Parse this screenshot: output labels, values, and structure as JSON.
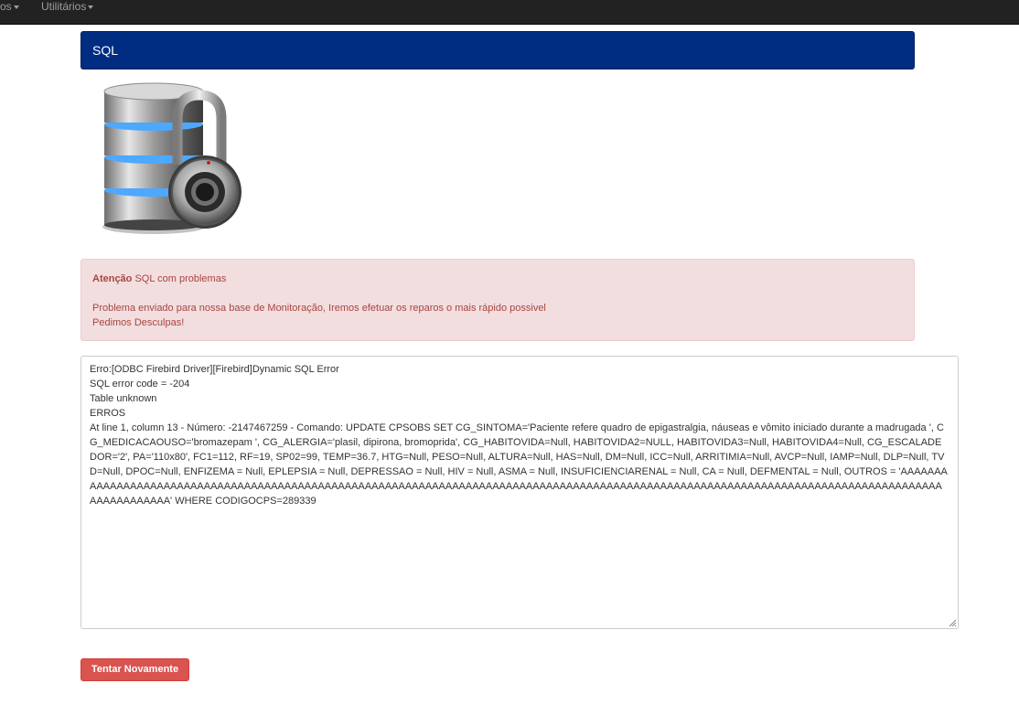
{
  "nav": {
    "items": [
      {
        "label": "os"
      },
      {
        "label": "Utilitários"
      }
    ]
  },
  "panel": {
    "title": "SQL"
  },
  "alert": {
    "strong": "Atenção",
    "headline": " SQL com problemas",
    "line2": "Problema enviado para nossa base de Monitoração, Iremos efetuar os reparos o mais rápido possivel",
    "line3": "Pedimos Desculpas!"
  },
  "error": {
    "lines": [
      "Erro:[ODBC Firebird Driver][Firebird]Dynamic SQL Error",
      "SQL error code = -204",
      "Table unknown",
      "ERROS",
      "At line 1, column 13 - Número: -2147467259 - Comando: UPDATE CPSOBS SET CG_SINTOMA='Paciente refere quadro de epigastralgia, náuseas e vômito iniciado durante a madrugada ', CG_MEDICACAOUSO='bromazepam ', CG_ALERGIA='plasil, dipirona, bromoprida', CG_HABITOVIDA=Null, HABITOVIDA2=NULL, HABITOVIDA3=Null, HABITOVIDA4=Null, CG_ESCALADEDOR='2', PA='110x80', FC1=112, RF=19, SP02=99, TEMP=36.7, HTG=Null, PESO=Null, ALTURA=Null, HAS=Null, DM=Null, ICC=Null, ARRITIMIA=Null, AVCP=Null, IAMP=Null, DLP=Null, TVD=Null, DPOC=Null, ENFIZEMA = Null, EPLEPSIA = Null, DEPRESSAO = Null, HIV = Null, ASMA = Null, INSUFICIENCIARENAL = Null, CA = Null, DEFMENTAL = Null, OUTROS = 'AAAAAAAAAAAAAAAAAAAAAAAAAAAAAAAAAAAAAAAAAAAAAAAAAAAAAAAAAAAAAAAAAAAAAAAAAAAAAAAAAAAAAAAAAAAAAAAAAAAAAAAAAAAAAAAAAAAAAAAAAAAAAAAAAAAAAAAAAAAAAAAAAA' WHERE CODIGOCPS=289339"
    ]
  },
  "retry_button": {
    "label": "Tentar Novamente"
  },
  "icons": {
    "image": "database-lock-image",
    "grip": "resize-grip-icon"
  },
  "colors": {
    "panel": "#002d82",
    "alert_bg": "#f2dede",
    "alert_text": "#a94442",
    "danger": "#d9534f",
    "navbar": "#222222"
  }
}
